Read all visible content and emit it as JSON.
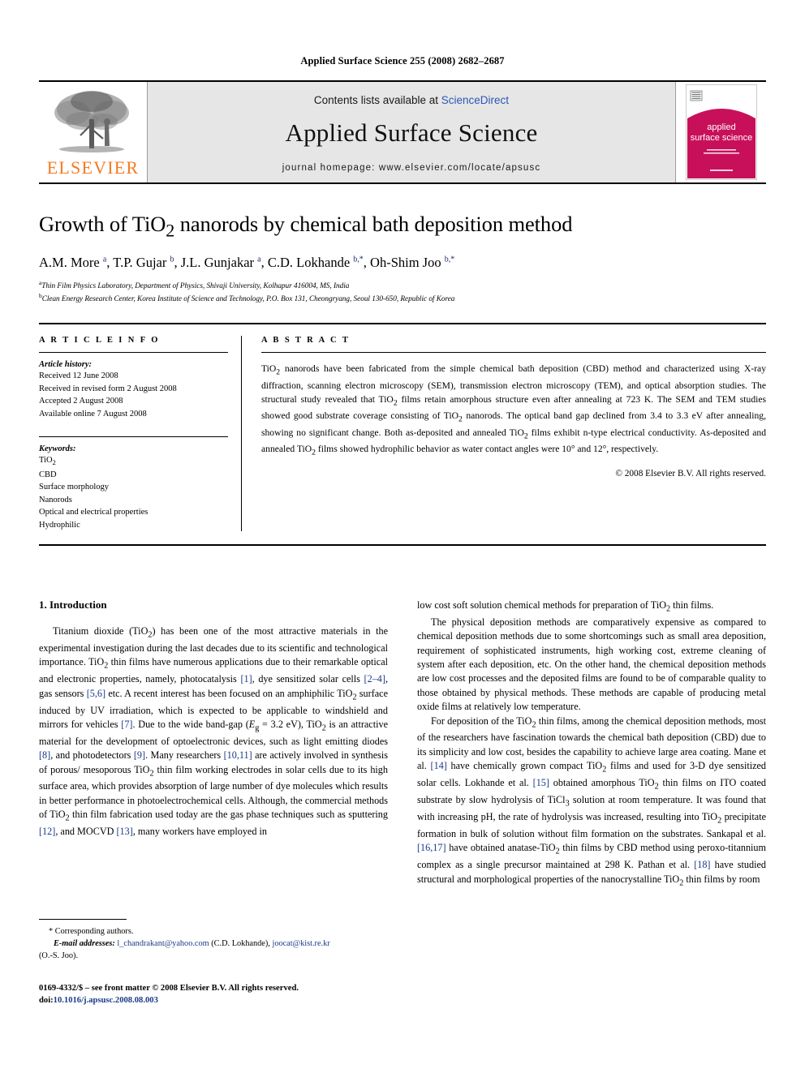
{
  "running_head": "Applied Surface Science 255 (2008) 2682–2687",
  "masthead": {
    "publisher_name": "ELSEVIER",
    "contents_prefix": "Contents lists available at",
    "sciencedirect": "ScienceDirect",
    "journal_title": "Applied Surface Science",
    "homepage": "journal homepage: www.elsevier.com/locate/apsusc",
    "cover_title_line1": "applied",
    "cover_title_line2": "surface science",
    "colors": {
      "elsevier_orange": "#F47B20",
      "link_blue": "#2b57b5",
      "cover_magenta": "#C8105A",
      "band_grey": "#e6e6e6"
    }
  },
  "article": {
    "title": "Growth of TiO2 nanorods by chemical bath deposition method",
    "authors": "A.M. More a, T.P. Gujar b, J.L. Gunjakar a, C.D. Lokhande b,*, Oh-Shim Joo b,*",
    "affiliation_a": "Thin Film Physics Laboratory, Department of Physics, Shivaji University, Kolhapur 416004, MS, India",
    "affiliation_b": "Clean Energy Research Center, Korea Institute of Science and Technology, P.O. Box 131, Cheongryang, Seoul 130-650, Republic of Korea"
  },
  "article_info": {
    "heading": "A R T I C L E   I N F O",
    "history_label": "Article history:",
    "history": [
      "Received 12 June 2008",
      "Received in revised form 2 August 2008",
      "Accepted 2 August 2008",
      "Available online 7 August 2008"
    ],
    "keywords_label": "Keywords:",
    "keywords": [
      "TiO2",
      "CBD",
      "Surface morphology",
      "Nanorods",
      "Optical and electrical properties",
      "Hydrophilic"
    ]
  },
  "abstract": {
    "heading": "A B S T R A C T",
    "text": "TiO2 nanorods have been fabricated from the simple chemical bath deposition (CBD) method and characterized using X-ray diffraction, scanning electron microscopy (SEM), transmission electron microscopy (TEM), and optical absorption studies. The structural study revealed that TiO2 films retain amorphous structure even after annealing at 723 K. The SEM and TEM studies showed good substrate coverage consisting of TiO2 nanorods. The optical band gap declined from 3.4 to 3.3 eV after annealing, showing no significant change. Both as-deposited and annealed TiO2 films exhibit n-type electrical conductivity. As-deposited and annealed TiO2 films showed hydrophilic behavior as water contact angles were 10° and 12°, respectively.",
    "copyright": "© 2008 Elsevier B.V. All rights reserved."
  },
  "body": {
    "section_title": "1. Introduction",
    "left_para_1_part1": "Titanium dioxide (TiO2) has been one of the most attractive materials in the experimental investigation during the last decades due to its scientific and technological importance. TiO2 thin films have numerous applications due to their remarkable optical and electronic properties, namely, photocatalysis ",
    "ref1": "[1]",
    "left_para_1_part2": ", dye sensitized solar cells ",
    "ref2": "[2–4]",
    "left_para_1_part3": ", gas sensors ",
    "ref3": "[5,6]",
    "left_para_1_part4": " etc. A recent interest has been focused on an amphiphilic TiO2 surface induced by UV irradiation, which is expected to be applicable to windshield and mirrors for vehicles ",
    "ref4": "[7]",
    "left_para_1_part5": ". Due to the wide band-gap (Eg = 3.2 eV), TiO2 is an attractive material for the development of optoelectronic devices, such as light emitting diodes ",
    "ref5": "[8]",
    "left_para_1_part6": ", and photodetectors ",
    "ref6": "[9]",
    "left_para_1_part7": ". Many researchers ",
    "ref7": "[10,11]",
    "left_para_1_part8": " are actively involved in synthesis of porous/mesoporous TiO2 thin film working electrodes in solar cells due to its high surface area, which provides absorption of large number of dye molecules which results in better performance in photoelectrochemical cells. Although, the commercial methods of TiO2 thin film fabrication used today are the gas phase techniques such as sputtering ",
    "ref8": "[12]",
    "left_para_1_part9": ", and MOCVD ",
    "ref9": "[13]",
    "left_para_1_part10": ", many workers have employed in",
    "right_para_cont": "low cost soft solution chemical methods for preparation of TiO2 thin films.",
    "right_para_2": "The physical deposition methods are comparatively expensive as compared to chemical deposition methods due to some shortcomings such as small area deposition, requirement of sophisticated instruments, high working cost, extreme cleaning of system after each deposition, etc. On the other hand, the chemical deposition methods are low cost processes and the deposited films are found to be of comparable quality to those obtained by physical methods. These methods are capable of producing metal oxide films at relatively low temperature.",
    "right_para_3_part1": "For deposition of the TiO2 thin films, among the chemical deposition methods, most of the researchers have fascination towards the chemical bath deposition (CBD) due to its simplicity and low cost, besides the capability to achieve large area coating. Mane et al. ",
    "ref14": "[14]",
    "right_para_3_part2": " have chemically grown compact TiO2 films and used for 3-D dye sensitized solar cells. Lokhande et al. ",
    "ref15": "[15]",
    "right_para_3_part3": " obtained amorphous TiO2 thin films on ITO coated substrate by slow hydrolysis of TiCl3 solution at room temperature. It was found that with increasing pH, the rate of hydrolysis was increased, resulting into TiO2 precipitate formation in bulk of solution without film formation on the substrates. Sankapal et al. ",
    "ref1617": "[16,17]",
    "right_para_3_part4": " have obtained anatase-TiO2 thin films by CBD method using peroxo-titannium complex as a single precursor maintained at 298 K. Pathan et al. ",
    "ref18": "[18]",
    "right_para_3_part5": " have studied structural and morphological properties of the nanocrystalline TiO2 thin films by room"
  },
  "footnote": {
    "star": "*",
    "corresponding": "Corresponding authors.",
    "email_label": "E-mail addresses:",
    "email1": "l_chandrakant@yahoo.com",
    "email1_owner": "(C.D. Lokhande),",
    "email2": "joocat@kist.re.kr",
    "email2_owner": "(O.-S. Joo)."
  },
  "footer": {
    "issn_line": "0169-4332/$ – see front matter © 2008 Elsevier B.V. All rights reserved.",
    "doi_label": "doi:",
    "doi_value": "10.1016/j.apsusc.2008.08.003"
  }
}
